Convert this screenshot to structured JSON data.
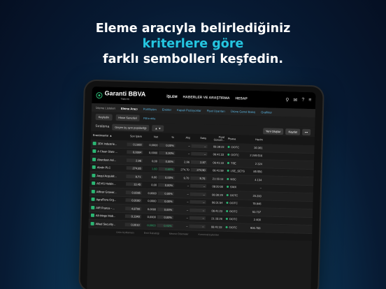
{
  "headline": {
    "line1": "Eleme aracıyla belirlediğiniz",
    "line2": "kriterlere göre",
    "line3": "farklı sembolleri keşfedin."
  },
  "app": {
    "brand": "Garanti BBVA",
    "brand_sub": "Yatırım",
    "nav": [
      "İŞLEM",
      "HABERLER VE ARAŞTIRMA",
      "HESAP"
    ],
    "subnav": [
      "İzleme Listeleri",
      "Eleme Aracı",
      "Portföyüm",
      "Emirler",
      "Kapalı Pozisyonlar",
      "Fiyat Uyarıları",
      "Ürüne Genel Bakış",
      "Grafikler"
    ],
    "subnav_active_index": 1,
    "filter_first": "Keşfedin",
    "filter_second": "Hisse Senetleri",
    "filter_link": "Filtre ekle",
    "sort_label": "Sıralama",
    "sort_value": "Geçen üç ayın popülerliği",
    "sort_dir": "▲ ▼",
    "new_create": "Yeni Oluştur",
    "save": "Kaydet",
    "more": "•••",
    "columns": {
      "instruments": "Enstrümanlar ▲",
      "last_price": "Son İşlem",
      "net": "Net",
      "pct": "%",
      "bid": "Alış",
      "ask": "Satış",
      "price_update": "Fiyat Güncel...",
      "market": "Piyasa",
      "volume": "Hacim"
    },
    "rows": [
      {
        "sym": "3DX Industrie...",
        "last": "0,1000",
        "net": "0,0000",
        "pct": "0,00%",
        "bid": "–",
        "ask": "–",
        "time": "06:39:23",
        "mkt": "OOTC",
        "vol": "30.361"
      },
      {
        "sym": "A Clean Slate ...",
        "last": "0,0004",
        "net": "0,0000",
        "pct": "0,00%",
        "bid": "–",
        "ask": "–",
        "time": "06:41:33",
        "mkt": "OOTC",
        "vol": "2.249.516"
      },
      {
        "sym": "Aberdeen Asi...",
        "last": "2,96",
        "net": "0,00",
        "pct": "0,00%",
        "bid": "2,96",
        "ask": "2,97",
        "time": "06:41:33",
        "mkt": "TSE",
        "vol": "2.324"
      },
      {
        "sym": "Abrdn PLC",
        "last": "274,85",
        "net": "1,60",
        "pct": "0,60%",
        "bid": "274,70",
        "ask": "274,90",
        "time": "06:41:59",
        "mkt": "LSE_SETS",
        "vol": "85.556"
      },
      {
        "sym": "Aequi Acquisit...",
        "last": "9,71",
        "net": "0,00",
        "pct": "0,00%",
        "bid": "9,70",
        "ask": "9,76",
        "time": "21:15:13",
        "mkt": "NSC",
        "vol": "4.134"
      },
      {
        "sym": "AEVIS Holdin...",
        "last": "13,45",
        "net": "0,00",
        "pct": "0,00%",
        "bid": "–",
        "ask": "–",
        "time": "08:20:00",
        "mkt": "SWX",
        "vol": "–"
      },
      {
        "sym": "Affinor Grower...",
        "last": "0,0285",
        "net": "0,0000",
        "pct": "0,00%",
        "bid": "–",
        "ask": "–",
        "time": "06:30:29",
        "mkt": "OOTC",
        "vol": "20.200"
      },
      {
        "sym": "AgraFlora Org...",
        "last": "0,0100",
        "net": "0,0000",
        "pct": "0,00%",
        "bid": "–",
        "ask": "–",
        "time": "06:31:54",
        "mkt": "OOTC",
        "vol": "78.946"
      },
      {
        "sym": "AIR France - ...",
        "last": "4,8700",
        "net": "0,0000",
        "pct": "0,00%",
        "bid": "–",
        "ask": "–",
        "time": "06:41:23",
        "mkt": "OOTC",
        "vol": "53.737"
      },
      {
        "sym": "All things Mob...",
        "last": "0,1340",
        "net": "0,0000",
        "pct": "0,00%",
        "bid": "–",
        "ask": "–",
        "time": "21:15:26",
        "mkt": "OOTC",
        "vol": "2.400"
      },
      {
        "sym": "Allied Security...",
        "last": "0,0010",
        "net": "0,0003",
        "pct": "0,43%",
        "bid": "–",
        "ask": "–",
        "time": "06:41:33",
        "mkt": "OOTC",
        "vol": "906.788"
      }
    ],
    "footer": [
      "Ürün Açıklaması",
      "Emir Rahatlığı",
      "Mevcut Ödemeler",
      "Kurumsal Eylemler"
    ]
  },
  "colors": {
    "accent": "#25c6e0",
    "positive": "#2bb673",
    "link": "#5ab4e0"
  }
}
